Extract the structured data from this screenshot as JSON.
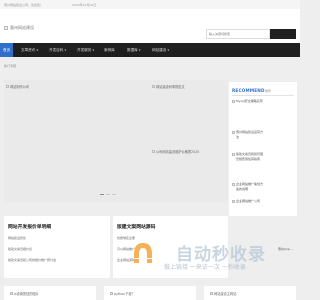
{
  "topbar": {
    "welcome": "惠州网站建设公司，欢迎您！",
    "date": "2025年10月02日"
  },
  "header": {
    "logo_alt": "惠州网站建设",
    "search_placeholder": "输入关键词搜索"
  },
  "nav": {
    "items": [
      {
        "label": "首页",
        "active": true,
        "caret": false
      },
      {
        "label": "文章资讯",
        "active": false,
        "caret": true
      },
      {
        "label": "开发百科",
        "active": false,
        "caret": true
      },
      {
        "label": "开发服务",
        "active": false,
        "caret": true
      },
      {
        "label": "案例库",
        "active": false,
        "caret": false
      },
      {
        "label": "数据库",
        "active": false,
        "caret": true
      },
      {
        "label": "网站建设",
        "active": false,
        "caret": true
      }
    ]
  },
  "breadcrumb": "热门专题",
  "slides": {
    "s1": "网站制作公司",
    "s2": "网站建设利率报告文",
    "s3": "公司网站建设维护价格表2025"
  },
  "recommend": {
    "title": "RECOMMEND",
    "subtitle": "推荐",
    "items": [
      "Mysql安全策略实现",
      "惠州网站建设运营方法",
      "版建文案员和和管理员规费用估算指南",
      "企业网站推广策划方案的说明",
      "企业网站推广公司"
    ]
  },
  "cards": [
    {
      "title": "网站开发报价单明细",
      "links": [
        "网站建设优化",
        "版建文案员报价表",
        "版建文案员和公司的报价推广研讨会"
      ]
    },
    {
      "title": "版建文案网站源码",
      "links": [
        "优质域名注册",
        "可以网站推广",
        "企业网站源码"
      ]
    }
  ],
  "watermark": {
    "name": "自动秒收录",
    "tagline": "做上链接 一来访一次 一秒收录"
  },
  "side_snippet": "惠州php...",
  "bottom": {
    "b1": "js设置按钮的图片",
    "b2": "python下载？",
    "b3": "网站建设主网站"
  }
}
